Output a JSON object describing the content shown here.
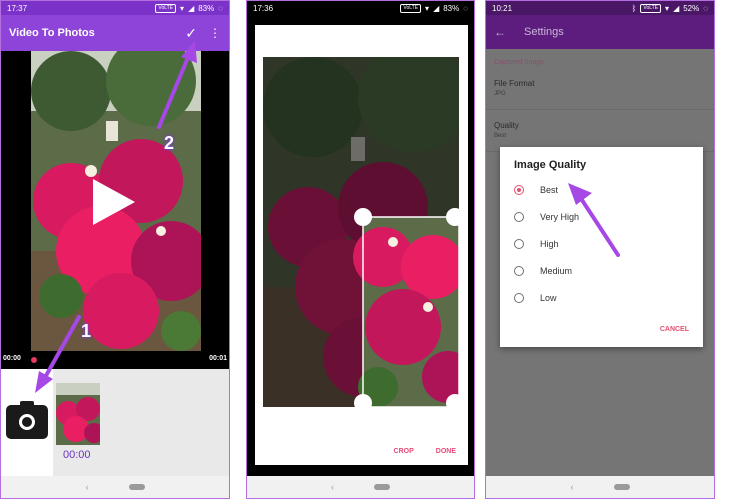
{
  "phone1": {
    "status": {
      "time": "17:37",
      "volte": "VoLTE",
      "battery": "83%"
    },
    "app_title": "Video To Photos",
    "time_start": "00:00",
    "time_end": "00:01",
    "thumb_time": "00:00",
    "badge_1": "1",
    "badge_2": "2"
  },
  "phone2": {
    "status": {
      "time": "17:36",
      "volte": "VoLTE",
      "battery": "83%"
    },
    "crop_label": "CROP",
    "done_label": "DONE"
  },
  "phone3": {
    "status": {
      "time": "10:21",
      "volte": "VoLTE",
      "battery": "52%"
    },
    "title": "Settings",
    "section": "Captured Image",
    "file_format_title": "File Format",
    "file_format_value": "JPG",
    "quality_title": "Quality",
    "quality_value": "Best",
    "dialog": {
      "title": "Image Quality",
      "options": [
        "Best",
        "Very High",
        "High",
        "Medium",
        "Low"
      ],
      "selected": "Best",
      "cancel": "CANCEL"
    }
  },
  "colors": {
    "accent": "#8f44d9",
    "pink": "#e2516f",
    "arrow": "#a548e6"
  }
}
